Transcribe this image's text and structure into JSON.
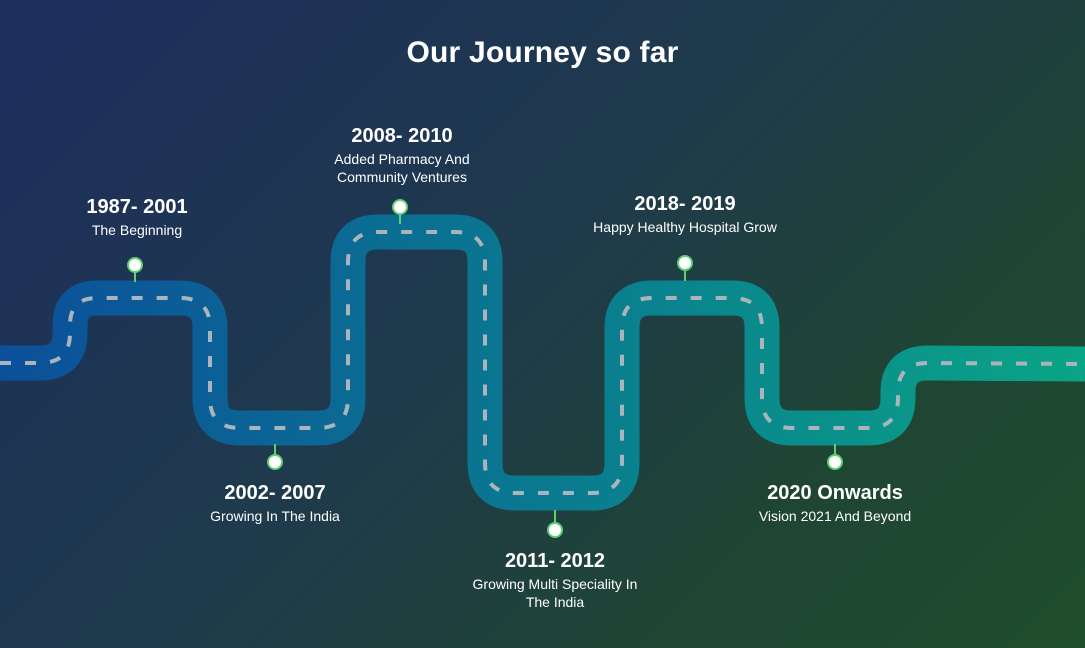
{
  "title": "Our Journey so far",
  "colors": {
    "road_start": "#0b4f9a",
    "road_end": "#0aa486",
    "dashes": "#a9b4bc",
    "pin": "#ffffff",
    "pin_ring": "#5fcf74"
  },
  "milestones": [
    {
      "years": "1987- 2001",
      "desc": "The Beginning"
    },
    {
      "years": "2002- 2007",
      "desc": "Growing In The India"
    },
    {
      "years": "2008- 2010",
      "desc": "Added Pharmacy And Community Ventures"
    },
    {
      "years": "2011- 2012",
      "desc": "Growing Multi Speciality In The India"
    },
    {
      "years": "2018- 2019",
      "desc": "Happy Healthy Hospital Grow"
    },
    {
      "years": "2020 Onwards",
      "desc": "Vision 2021 And Beyond"
    }
  ]
}
